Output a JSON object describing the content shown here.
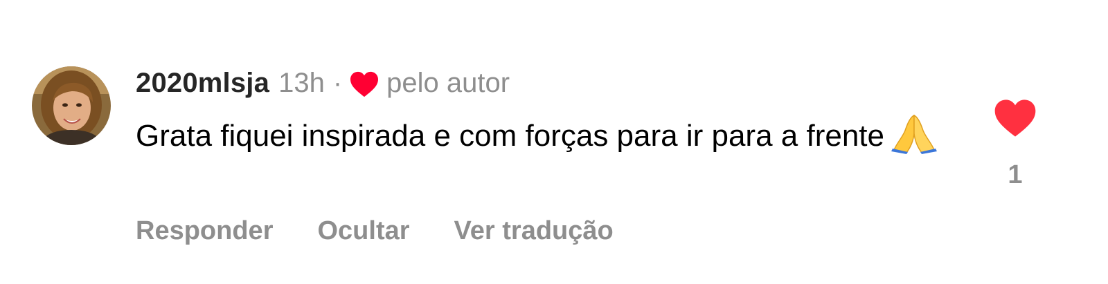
{
  "comment": {
    "username": "2020mlsja",
    "time": "13h",
    "separator": "·",
    "author_like_label": "pelo autor",
    "text": "Grata fiquei inspirada e com forças para ir para a frente",
    "emoji": "folded-hands",
    "like_icon": "heart-filled-icon",
    "like_color": "#ff3040",
    "like_count": "1"
  },
  "actions": {
    "reply_label": "Responder",
    "hide_label": "Ocultar",
    "translate_label": "Ver tradução"
  }
}
